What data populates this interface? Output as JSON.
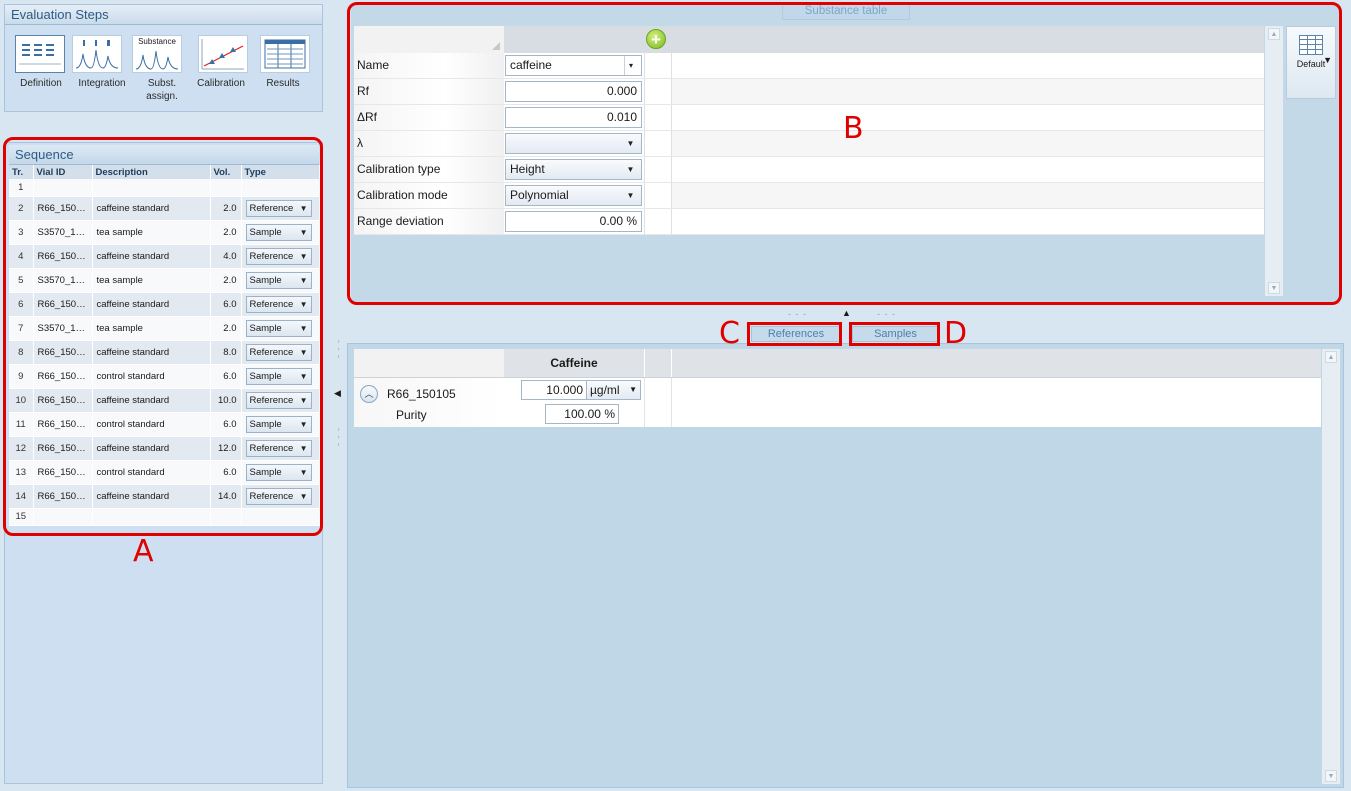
{
  "evaluation_steps": {
    "title": "Evaluation Steps",
    "steps": [
      {
        "label": "Definition",
        "icon": "definition-icon"
      },
      {
        "label": "Integration",
        "icon": "integration-icon"
      },
      {
        "label": "Subst.\nassign.",
        "caption": "Substance",
        "icon": "substance-assign-icon"
      },
      {
        "label": "Calibration",
        "icon": "calibration-icon"
      },
      {
        "label": "Results",
        "icon": "results-icon"
      }
    ]
  },
  "sequence": {
    "title": "Sequence",
    "columns": [
      "Tr.",
      "Vial ID",
      "Description",
      "Vol.",
      "Type"
    ],
    "rows": [
      {
        "tr": "1",
        "vial": "",
        "desc": "",
        "vol": "",
        "type": ""
      },
      {
        "tr": "2",
        "vial": "R66_1501...",
        "desc": "caffeine standard",
        "vol": "2.0",
        "type": "Reference"
      },
      {
        "tr": "3",
        "vial": "S3570_15...",
        "desc": "tea sample",
        "vol": "2.0",
        "type": "Sample"
      },
      {
        "tr": "4",
        "vial": "R66_1501...",
        "desc": "caffeine standard",
        "vol": "4.0",
        "type": "Reference"
      },
      {
        "tr": "5",
        "vial": "S3570_15...",
        "desc": "tea sample",
        "vol": "2.0",
        "type": "Sample"
      },
      {
        "tr": "6",
        "vial": "R66_1501...",
        "desc": "caffeine standard",
        "vol": "6.0",
        "type": "Reference"
      },
      {
        "tr": "7",
        "vial": "S3570_15...",
        "desc": "tea sample",
        "vol": "2.0",
        "type": "Sample"
      },
      {
        "tr": "8",
        "vial": "R66_1501...",
        "desc": "caffeine standard",
        "vol": "8.0",
        "type": "Reference"
      },
      {
        "tr": "9",
        "vial": "R66_1501...",
        "desc": "control standard",
        "vol": "6.0",
        "type": "Sample"
      },
      {
        "tr": "10",
        "vial": "R66_1501...",
        "desc": "caffeine standard",
        "vol": "10.0",
        "type": "Reference"
      },
      {
        "tr": "11",
        "vial": "R66_1501...",
        "desc": "control standard",
        "vol": "6.0",
        "type": "Sample"
      },
      {
        "tr": "12",
        "vial": "R66_1501...",
        "desc": "caffeine standard",
        "vol": "12.0",
        "type": "Reference"
      },
      {
        "tr": "13",
        "vial": "R66_1501...",
        "desc": "control standard",
        "vol": "6.0",
        "type": "Sample"
      },
      {
        "tr": "14",
        "vial": "R66_1501...",
        "desc": "caffeine standard",
        "vol": "14.0",
        "type": "Reference"
      },
      {
        "tr": "15",
        "vial": "",
        "desc": "",
        "vol": "",
        "type": ""
      }
    ]
  },
  "substance_table": {
    "tab_label": "Substance table",
    "rows": {
      "name": {
        "label": "Name",
        "value": "caffeine"
      },
      "rf": {
        "label": "Rf",
        "value": "0.000"
      },
      "drf": {
        "label": "ΔRf",
        "value": "0.010"
      },
      "lambda": {
        "label": "λ",
        "value": ""
      },
      "cal_type": {
        "label": "Calibration type",
        "value": "Height"
      },
      "cal_mode": {
        "label": "Calibration mode",
        "value": "Polynomial"
      },
      "range_dev": {
        "label": "Range deviation",
        "value": "0.00 %"
      }
    },
    "layout_button": "Default"
  },
  "sub_tabs": {
    "references": "References",
    "samples": "Samples"
  },
  "references_table": {
    "column": "Caffeine",
    "row": {
      "id": "R66_150105",
      "amount": "10.000",
      "unit": "µg/ml",
      "purity_label": "Purity",
      "purity": "100.00 %"
    }
  },
  "annotations": {
    "a": "A",
    "b": "B",
    "c": "C",
    "d": "D"
  },
  "colors": {
    "annotation": "#e00000",
    "panel": "#c3d9e8",
    "header_text": "#2e5a86"
  }
}
